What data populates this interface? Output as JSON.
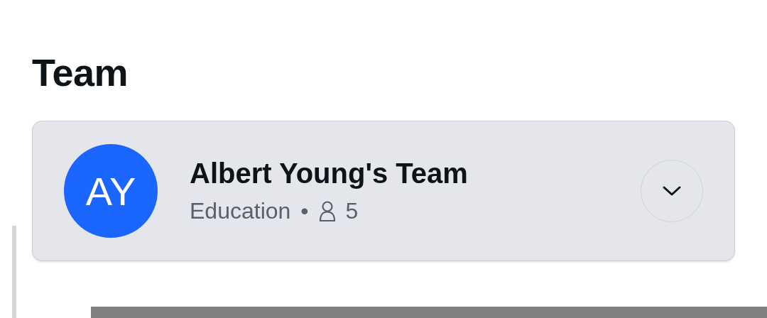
{
  "heading": "Team",
  "team": {
    "initials": "AY",
    "name": "Albert Young's Team",
    "category": "Education",
    "separator": "•",
    "member_count": "5",
    "expanded": false
  }
}
